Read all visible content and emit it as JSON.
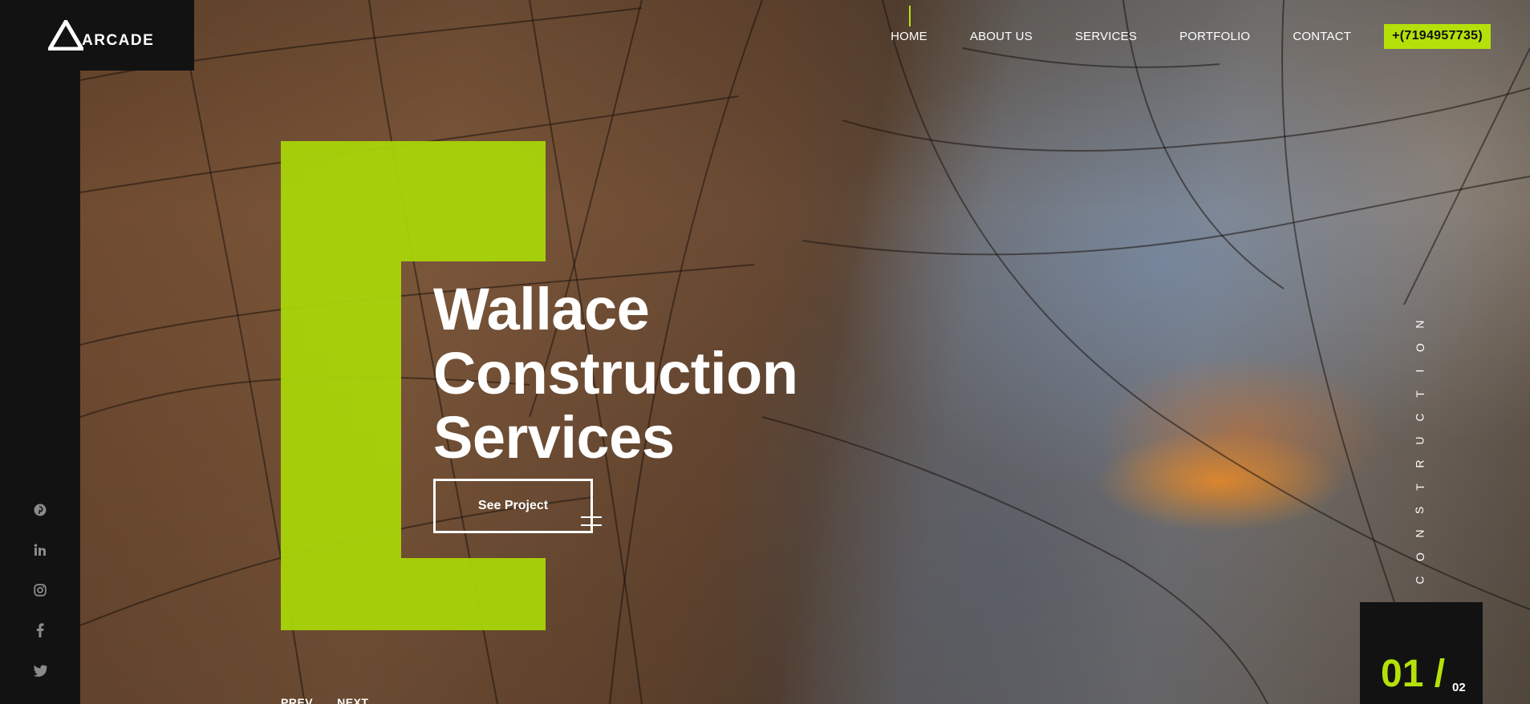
{
  "brand": {
    "name": "ARCADE"
  },
  "nav": {
    "items": [
      {
        "label": "HOME",
        "active": true
      },
      {
        "label": "ABOUT US",
        "active": false
      },
      {
        "label": "SERVICES",
        "active": false
      },
      {
        "label": "PORTFOLIO",
        "active": false
      },
      {
        "label": "CONTACT",
        "active": false
      }
    ],
    "phone": "+(7194957735)"
  },
  "hero": {
    "title_lines": [
      "Wallace",
      "Construction",
      "Services"
    ],
    "cta_label": "See Project",
    "prev_label": "PREV",
    "next_label": "NEXT",
    "vertical_word": "CONSTRUCTION"
  },
  "slider": {
    "current": "01 /",
    "total": "02"
  },
  "socials": [
    {
      "icon": "pinterest-icon",
      "glyph": "℗"
    },
    {
      "icon": "linkedin-icon",
      "glyph": "in"
    },
    {
      "icon": "instagram-icon",
      "glyph": "◎"
    },
    {
      "icon": "facebook-icon",
      "glyph": "f"
    },
    {
      "icon": "twitter-icon",
      "glyph": "🐦"
    }
  ],
  "colors": {
    "accent": "#b5e10a",
    "dark": "#121212"
  }
}
